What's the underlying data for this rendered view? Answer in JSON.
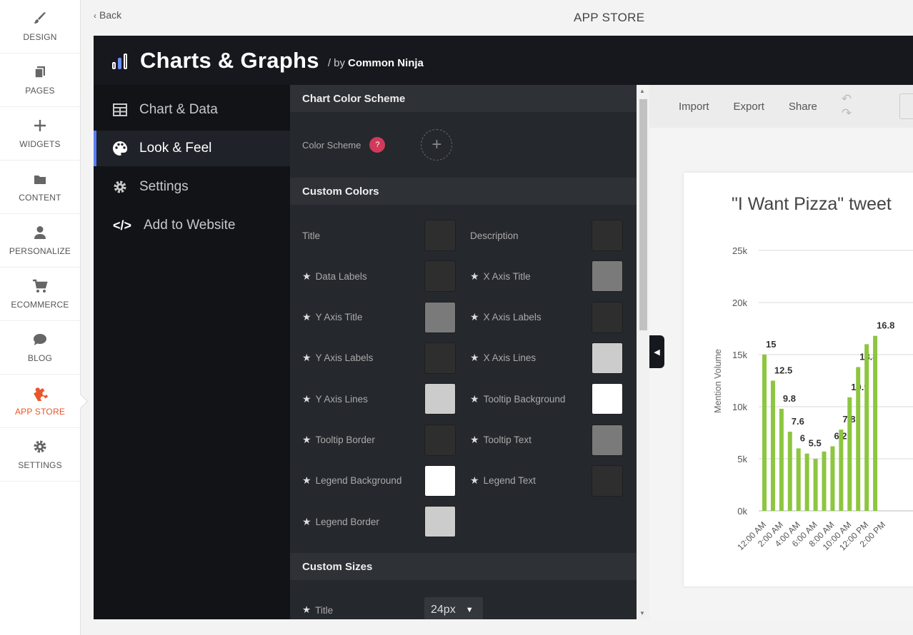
{
  "leftnav": [
    {
      "label": "DESIGN",
      "icon": "brush-icon"
    },
    {
      "label": "PAGES",
      "icon": "pages-icon"
    },
    {
      "label": "WIDGETS",
      "icon": "plus-icon"
    },
    {
      "label": "CONTENT",
      "icon": "folder-icon"
    },
    {
      "label": "PERSONALIZE",
      "icon": "user-icon"
    },
    {
      "label": "ECOMMERCE",
      "icon": "cart-icon"
    },
    {
      "label": "BLOG",
      "icon": "chat-icon"
    },
    {
      "label": "APP STORE",
      "icon": "puzzle-icon"
    },
    {
      "label": "SETTINGS",
      "icon": "gear-icon"
    }
  ],
  "topbar": {
    "back": "Back",
    "title": "APP STORE"
  },
  "app": {
    "name": "Charts & Graphs",
    "by_prefix": "/  by",
    "by": "Common Ninja"
  },
  "sidebar": [
    {
      "label": "Chart & Data"
    },
    {
      "label": "Look & Feel"
    },
    {
      "label": "Settings"
    },
    {
      "label": "Add to Website"
    }
  ],
  "panel": {
    "scheme_header": "Chart Color Scheme",
    "scheme_label": "Color Scheme",
    "help": "?",
    "custom_colors_header": "Custom Colors",
    "colors": [
      {
        "label": "Title",
        "color": "#2e2e2e",
        "star": false
      },
      {
        "label": "Description",
        "color": "#2e2e2e",
        "star": false
      },
      {
        "label": "Data Labels",
        "color": "#2e2e2e",
        "star": true
      },
      {
        "label": "X Axis Title",
        "color": "#7a7a7a",
        "star": true
      },
      {
        "label": "Y Axis Title",
        "color": "#7a7a7a",
        "star": true
      },
      {
        "label": "X Axis Labels",
        "color": "#2e2e2e",
        "star": true
      },
      {
        "label": "Y Axis Labels",
        "color": "#2e2e2e",
        "star": true
      },
      {
        "label": "X Axis Lines",
        "color": "#cccccc",
        "star": true
      },
      {
        "label": "Y Axis Lines",
        "color": "#cccccc",
        "star": true
      },
      {
        "label": "Tooltip Background",
        "color": "#ffffff",
        "star": true
      },
      {
        "label": "Tooltip Border",
        "color": "#2e2e2e",
        "star": true
      },
      {
        "label": "Tooltip Text",
        "color": "#7a7a7a",
        "star": true
      },
      {
        "label": "Legend Background",
        "color": "#ffffff",
        "star": true
      },
      {
        "label": "Legend Text",
        "color": "#2e2e2e",
        "star": true
      },
      {
        "label": "Legend Border",
        "color": "#cccccc",
        "star": true
      }
    ],
    "custom_sizes_header": "Custom Sizes",
    "size_label": "Title",
    "size_value": "24px"
  },
  "preview": {
    "tools": [
      "Import",
      "Export",
      "Share"
    ],
    "undo": "↶ ↷"
  },
  "chart_data": {
    "type": "bar",
    "title": "\"I Want Pizza\" tweet",
    "ylabel": "Mention Volume",
    "ylim": [
      0,
      25000
    ],
    "yticks": [
      "0k",
      "5k",
      "10k",
      "15k",
      "20k",
      "25k"
    ],
    "xticklabels": [
      "12:00 AM",
      "2:00 AM",
      "4:00 AM",
      "6:00 AM",
      "8:00 AM",
      "10:00 AM",
      "12:00 PM",
      "2:00 PM"
    ],
    "values": [
      15000,
      12500,
      9800,
      7600,
      6000,
      5500,
      5000,
      5700,
      6200,
      7800,
      10900,
      13800,
      16000,
      16800
    ],
    "data_labels": [
      "15",
      "12.5",
      "9.8",
      "7.6",
      "6",
      "5.5",
      "",
      "",
      "6.2",
      "7.8",
      "10.9",
      "13.8",
      "",
      "16.8"
    ],
    "color": "#8dc63f"
  }
}
